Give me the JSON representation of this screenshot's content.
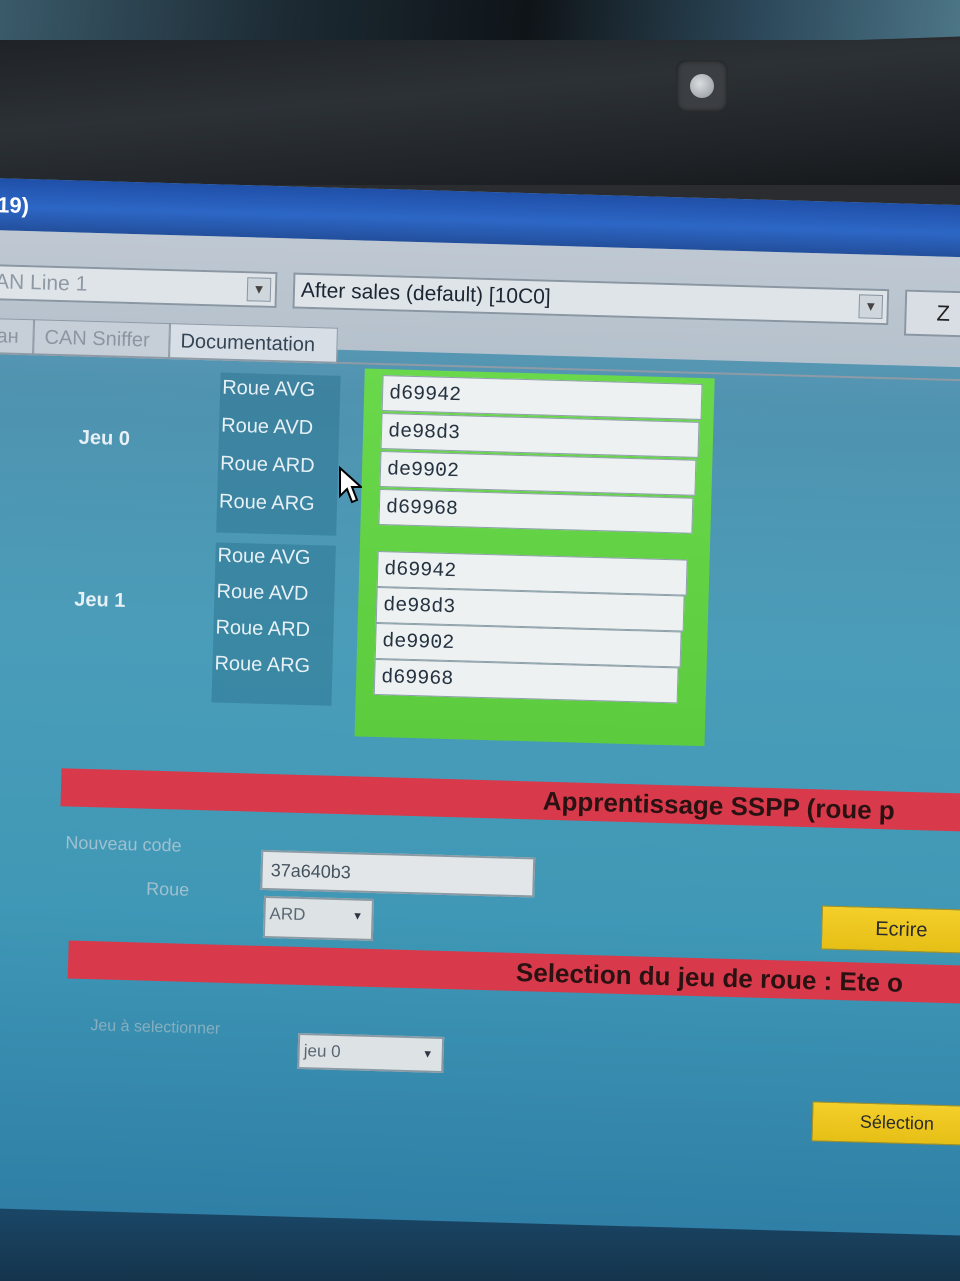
{
  "window": {
    "title": "19)"
  },
  "toolbar": {
    "can_line": {
      "value": "AN Line 1"
    },
    "session": {
      "value": "After sales (default) [10C0]"
    },
    "right_button": "Z"
  },
  "tabs": [
    {
      "label": "ан"
    },
    {
      "label": "CAN Sniffer"
    },
    {
      "label": "Documentation"
    }
  ],
  "sets": [
    {
      "name": "Jeu 0",
      "wheels": [
        {
          "label": "Roue AVG",
          "code": "d69942"
        },
        {
          "label": "Roue AVD",
          "code": "de98d3"
        },
        {
          "label": "Roue ARD",
          "code": "de9902"
        },
        {
          "label": "Roue ARG",
          "code": "d69968"
        }
      ]
    },
    {
      "name": "Jeu 1",
      "wheels": [
        {
          "label": "Roue AVG",
          "code": "d69942"
        },
        {
          "label": "Roue AVD",
          "code": "de98d3"
        },
        {
          "label": "Roue ARD",
          "code": "de9902"
        },
        {
          "label": "Roue ARG",
          "code": "d69968"
        }
      ]
    }
  ],
  "learning": {
    "banner": "Apprentissage SSPP (roue p",
    "new_code_label": "Nouveau code",
    "new_code_value": "37a640b3",
    "wheel_label": "Roue",
    "wheel_value": "ARD",
    "write_button": "Ecrire"
  },
  "selection": {
    "banner": "Selection du jeu de roue : Ete o",
    "set_label": "Jeu à selectionner",
    "set_value": "jeu 0",
    "select_button": "Sélection"
  },
  "colors": {
    "banner_red": "#d83a4b",
    "frame_green": "#5ccc3e",
    "button_yellow": "#f4cf2a",
    "titlebar_blue": "#2d67c6"
  }
}
